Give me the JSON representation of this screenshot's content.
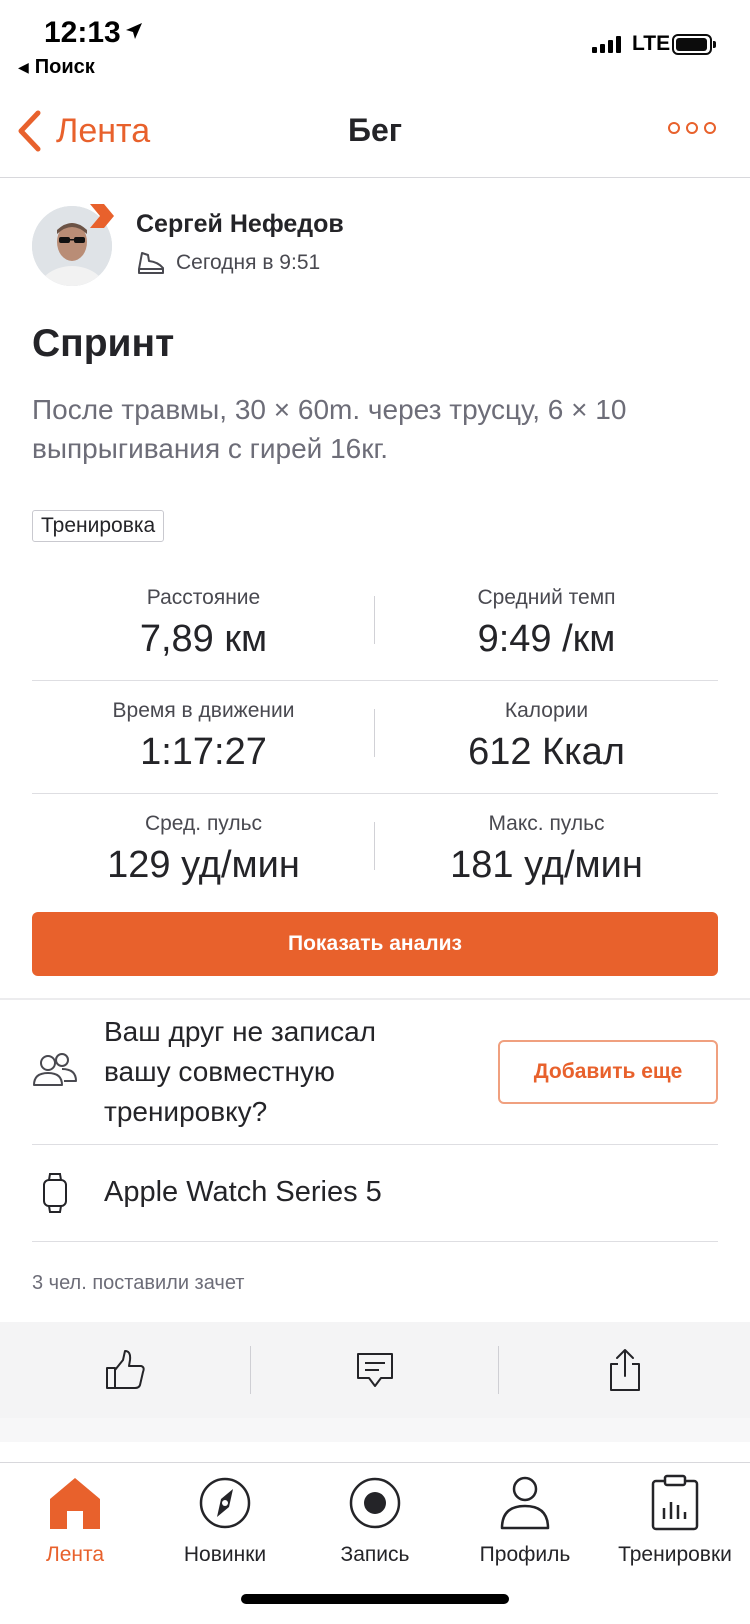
{
  "status_bar": {
    "time": "12:13",
    "back_app": "Поиск",
    "network": "LTE"
  },
  "nav": {
    "back_label": "Лента",
    "title": "Бег",
    "more_icon": "more-icon"
  },
  "author": {
    "name": "Сергей Нефедов",
    "time": "Сегодня в 9:51",
    "activity_icon": "shoe-icon"
  },
  "activity": {
    "title": "Спринт",
    "description": "После травмы, 30 × 60m. через трусцу, 6 × 10 выпрыгивания с гирей 16кг.",
    "tag": "Тренировка"
  },
  "stats": [
    {
      "label": "Расстояние",
      "value": "7,89 км"
    },
    {
      "label": "Средний темп",
      "value": "9:49 /км"
    },
    {
      "label": "Время в движении",
      "value": "1:17:27"
    },
    {
      "label": "Калории",
      "value": "612 Ккал"
    },
    {
      "label": "Сред. пульс",
      "value": "129 уд/мин"
    },
    {
      "label": "Макс. пульс",
      "value": "181 уд/мин"
    }
  ],
  "analysis_button": "Показать анализ",
  "friend_prompt": {
    "text": "Ваш друг не записал вашу совместную тренировку?",
    "button": "Добавить еще"
  },
  "device": {
    "name": "Apple Watch Series 5"
  },
  "kudos_text": "3 чел. поставили зачет",
  "tabs": [
    {
      "label": "Лента",
      "icon": "home-icon",
      "active": true
    },
    {
      "label": "Новинки",
      "icon": "compass-icon",
      "active": false
    },
    {
      "label": "Запись",
      "icon": "record-icon",
      "active": false
    },
    {
      "label": "Профиль",
      "icon": "profile-icon",
      "active": false
    },
    {
      "label": "Тренировки",
      "icon": "training-log-icon",
      "active": false
    }
  ],
  "colors": {
    "accent": "#e8612c",
    "text": "#242428",
    "muted": "#6d6d78"
  }
}
